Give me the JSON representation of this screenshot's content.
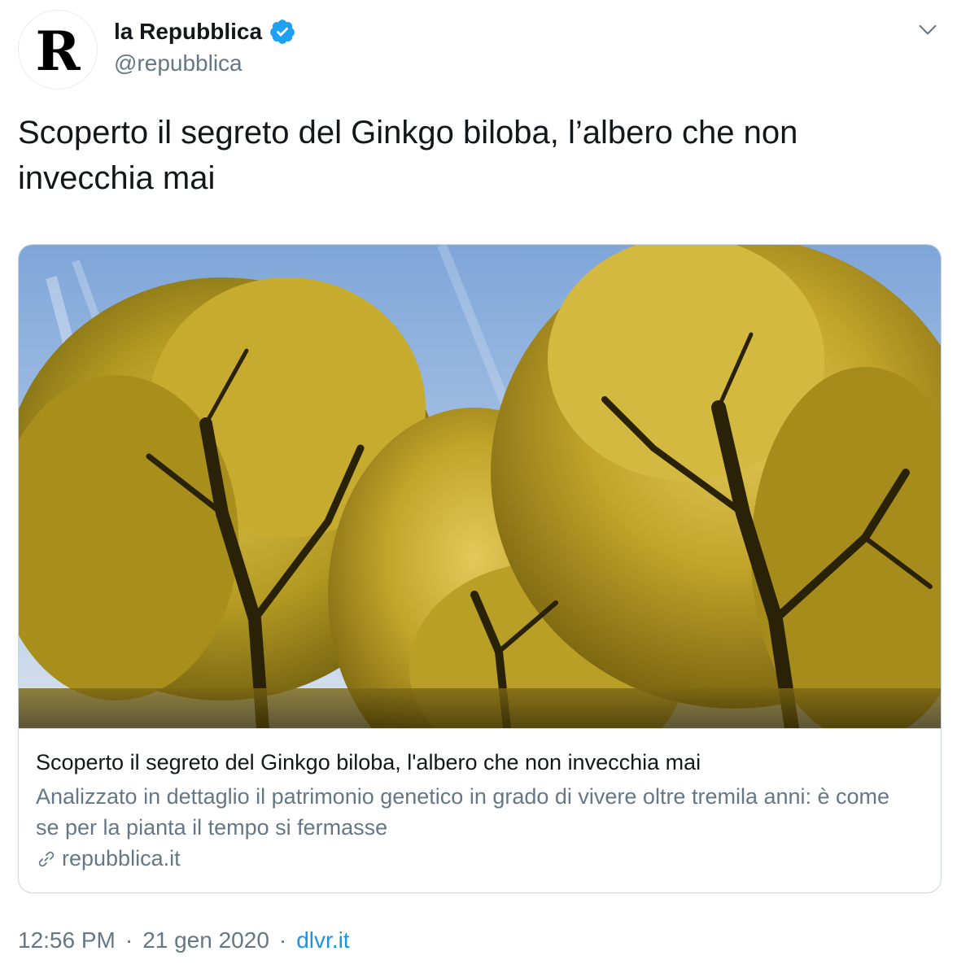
{
  "account": {
    "avatar_letter": "R",
    "display_name": "la Repubblica",
    "handle": "@repubblica",
    "verified": true,
    "verified_color": "#1da1f2"
  },
  "tweet": {
    "text": "Scoperto il segreto del Ginkgo biloba, l’albero che non invecchia mai"
  },
  "card": {
    "image_description": "ginkgo-trees-photo",
    "title": "Scoperto il segreto del Ginkgo biloba, l'albero che non invecchia mai",
    "description": "Analizzato in dettaglio il patrimonio genetico in grado di vivere oltre tremila anni: è come se per la pianta il tempo si fermasse",
    "domain": "repubblica.it"
  },
  "meta": {
    "time": "12:56 PM",
    "date": "21 gen 2020",
    "separator": "·",
    "source": "dlvr.it",
    "source_color": "#1b95e0"
  },
  "icons": {
    "menu": "chevron-down-icon",
    "verified": "verified-badge-icon",
    "link": "link-icon"
  }
}
